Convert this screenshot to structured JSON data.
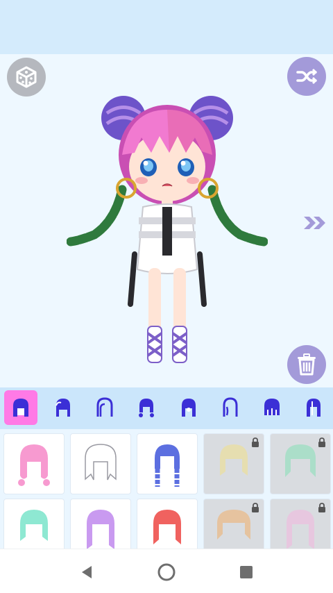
{
  "colors": {
    "header_bg": "#d4ebfc",
    "stage_bg": "#eef8ff",
    "accent_purple": "#a39ad9",
    "dice_gray": "#b5b8be",
    "tab_selected": "#ff7ae6",
    "tab_icon": "#3b2fd6"
  },
  "toolbar": {
    "dice_icon": "dice-icon",
    "shuffle_icon": "shuffle-icon",
    "trash_icon": "trash-icon",
    "next_icon": "double-chevron-right-icon"
  },
  "tabs": [
    {
      "icon": "hair-style-1-icon",
      "selected": true
    },
    {
      "icon": "hair-style-2-icon",
      "selected": false
    },
    {
      "icon": "hair-style-3-icon",
      "selected": false
    },
    {
      "icon": "hair-style-4-icon",
      "selected": false
    },
    {
      "icon": "hair-style-5-icon",
      "selected": false
    },
    {
      "icon": "hair-style-6-icon",
      "selected": false
    },
    {
      "icon": "hair-style-7-icon",
      "selected": false
    },
    {
      "icon": "hair-style-8-icon",
      "selected": false
    }
  ],
  "items": [
    {
      "color": "#f79ad0",
      "locked": false
    },
    {
      "color": "#ffffff",
      "locked": false
    },
    {
      "color": "#5c6fe0",
      "locked": false
    },
    {
      "color": "#f2e08a",
      "locked": true
    },
    {
      "color": "#86e0b7",
      "locked": true
    },
    {
      "color": "#8ee8d2",
      "locked": false
    },
    {
      "color": "#c99af0",
      "locked": false
    },
    {
      "color": "#f0625f",
      "locked": false
    },
    {
      "color": "#f0b06a",
      "locked": true
    },
    {
      "color": "#f3b6df",
      "locked": true
    }
  ],
  "navbar": {
    "back_icon": "back-triangle-icon",
    "home_icon": "home-circle-icon",
    "recents_icon": "recents-square-icon"
  }
}
